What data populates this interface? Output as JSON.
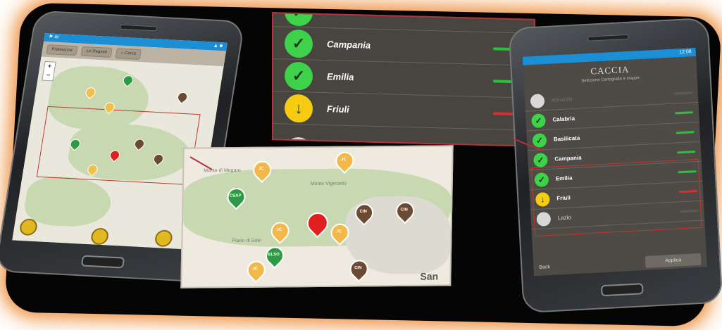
{
  "left_phone": {
    "toolbar": {
      "btn1": "Preferenze",
      "btn2": "Le Regioni",
      "btn3": "Cerca"
    },
    "zoom_plus": "+",
    "zoom_minus": "−",
    "pin_labels": [
      "JC",
      "JC",
      "JC",
      "JC"
    ]
  },
  "zoom_list": {
    "items": [
      {
        "name": "Campania",
        "status": "ok",
        "bar_color": "#2fbf3a"
      },
      {
        "name": "Emilia",
        "status": "ok",
        "bar_color": "#2fbf3a"
      },
      {
        "name": "Friuli",
        "status": "warn",
        "bar_color": "#d63030"
      }
    ]
  },
  "zoom_map": {
    "labels": {
      "place1": "Monte di Megaro",
      "place2": "Monte Vigeranto",
      "place3": "Piano di Sole",
      "san": "San"
    },
    "pins": [
      {
        "text": "JC",
        "color": "#f2b84a"
      },
      {
        "text": "JC",
        "color": "#f2b84a"
      },
      {
        "text": "CSAP",
        "color": "#2f9a46"
      },
      {
        "text": "JC",
        "color": "#f2b84a"
      },
      {
        "text": "JC",
        "color": "#f2b84a"
      },
      {
        "text": "CIN",
        "color": "#6a4a33"
      },
      {
        "text": "CIN",
        "color": "#6a4a33"
      },
      {
        "text": "ELSO",
        "color": "#2f9a46"
      },
      {
        "text": "JC",
        "color": "#f2b84a"
      },
      {
        "text": "CIN",
        "color": "#6a4a33"
      }
    ]
  },
  "right_phone": {
    "time": "12:08",
    "logo": "CACCIA",
    "subtitle": "Selezione Cartografia e mappe",
    "items": [
      {
        "name": "Abruzzo",
        "status": "off",
        "bar_color": "#5e5953"
      },
      {
        "name": "Calabria",
        "status": "ok",
        "bar_color": "#2fbf3a"
      },
      {
        "name": "Basilicata",
        "status": "ok",
        "bar_color": "#2fbf3a"
      },
      {
        "name": "Campania",
        "status": "ok",
        "bar_color": "#2fbf3a"
      },
      {
        "name": "Emilia",
        "status": "ok",
        "bar_color": "#2fbf3a"
      },
      {
        "name": "Friuli",
        "status": "warn",
        "bar_color": "#d63030"
      },
      {
        "name": "Lazio",
        "status": "off",
        "bar_color": "#5e5953"
      }
    ],
    "back_label": "Back",
    "apply_label": "Applica"
  },
  "icons": {
    "ok": "check-icon",
    "warn": "arrow-down-icon",
    "off": "empty-circle-icon",
    "pin": "map-pin-icon"
  }
}
